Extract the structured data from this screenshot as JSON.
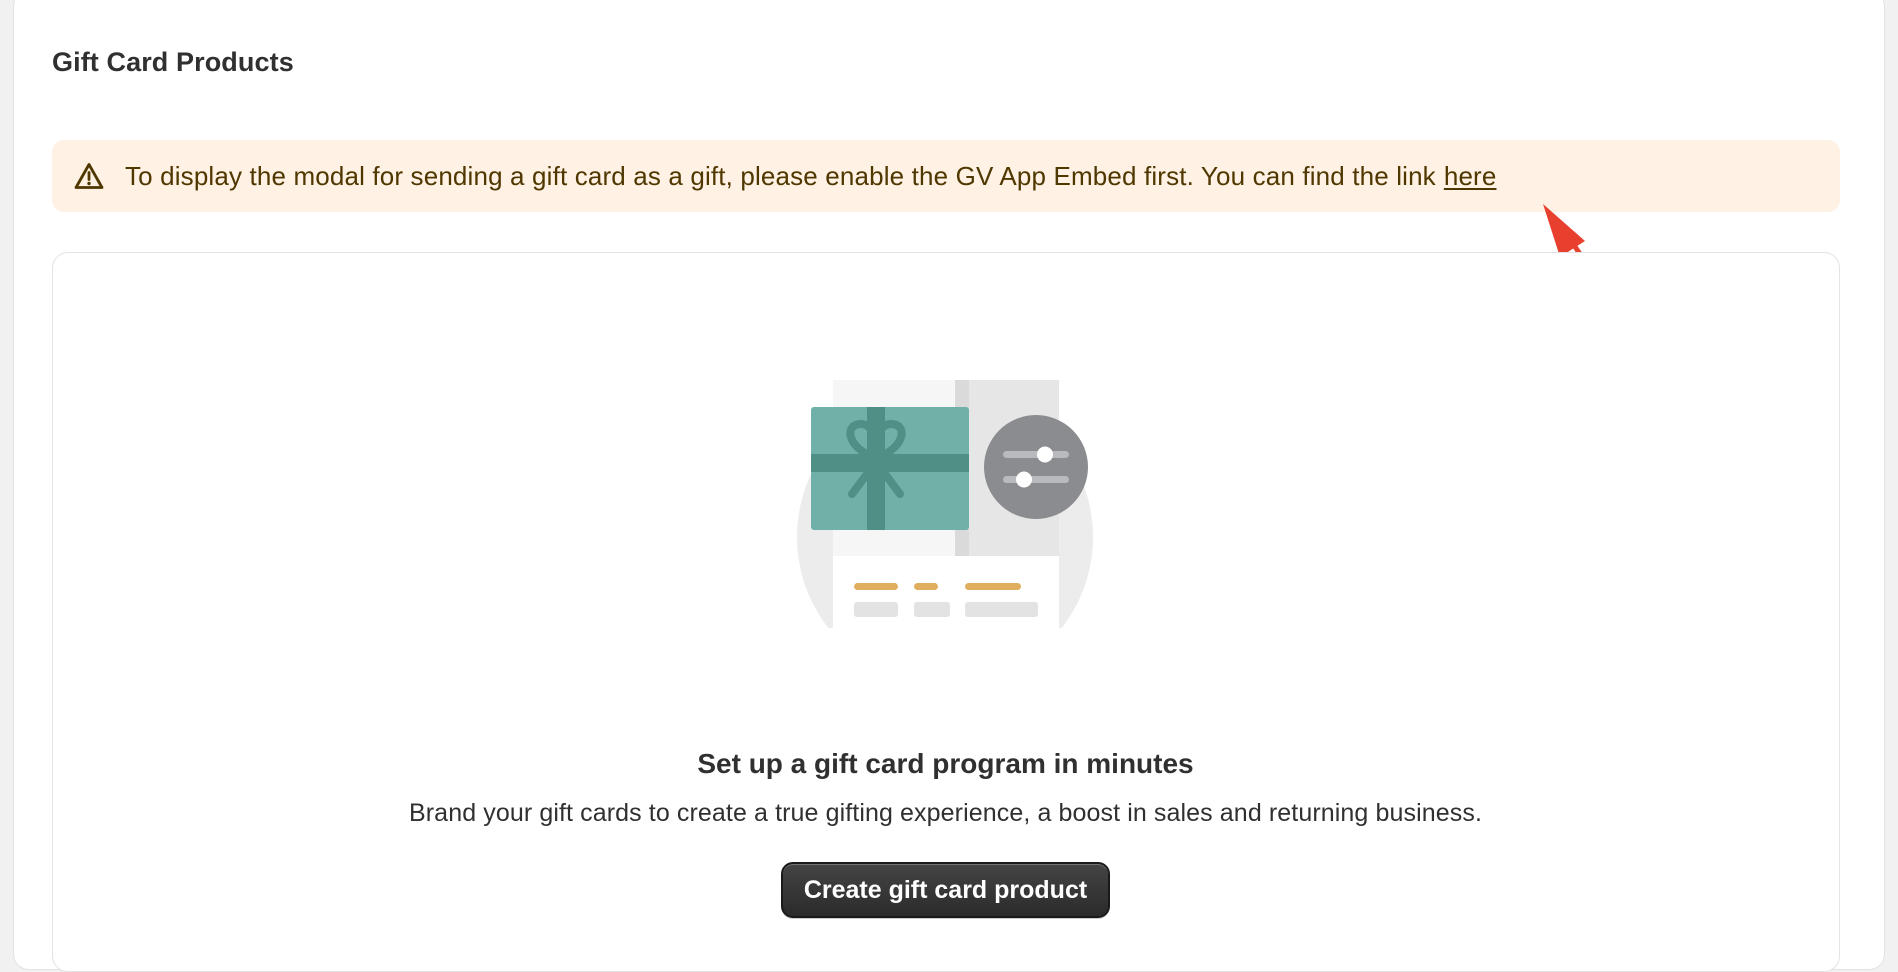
{
  "page": {
    "title": "Gift Card Products"
  },
  "banner": {
    "icon": "warning-icon",
    "message": "To display the modal for sending a gift card as a gift, please enable the GV App Embed first. You can find the link",
    "link_text": "here"
  },
  "empty_state": {
    "illustration": "gift-card-settings-illustration",
    "heading": "Set up a gift card program in minutes",
    "description": "Brand your gift cards to create a true gifting experience, a boost in sales and returning business.",
    "button_label": "Create gift card product"
  },
  "colors": {
    "banner_background": "#fff1e3",
    "banner_text": "#4f3700",
    "annotation_arrow": "#e8402f",
    "gift_teal": "#6fb0a8",
    "ribbon_teal": "#4e8f86",
    "button_dark": "#303030"
  }
}
